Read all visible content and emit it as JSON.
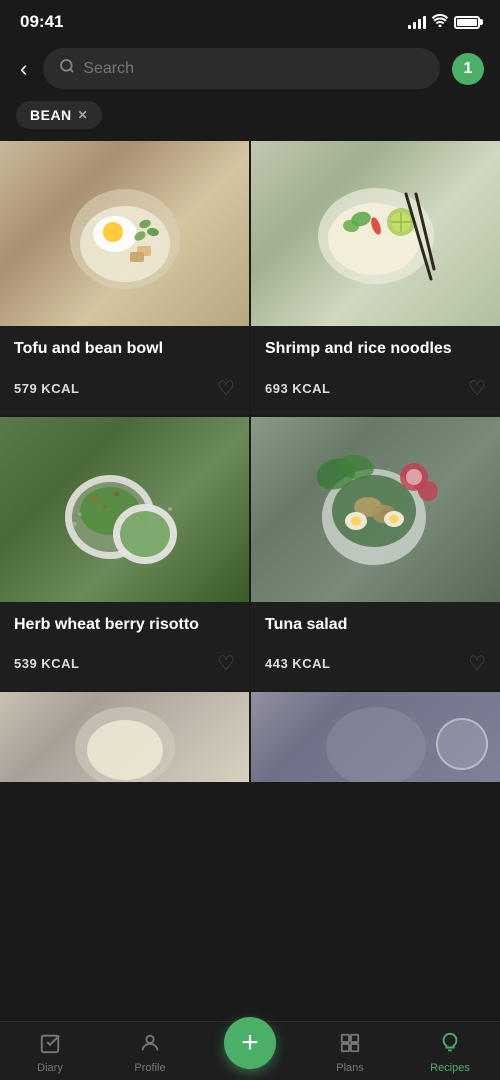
{
  "statusBar": {
    "time": "09:41",
    "signalBars": [
      4,
      7,
      10,
      13
    ],
    "batteryPercent": 85
  },
  "header": {
    "backLabel": "‹",
    "searchPlaceholder": "Search",
    "badgeCount": "1"
  },
  "filters": [
    {
      "label": "BEAN",
      "removable": true
    }
  ],
  "recipes": [
    {
      "id": "tofu-bean-bowl",
      "title": "Tofu and bean bowl",
      "kcal": "579 KCAL",
      "imgType": "tofu",
      "liked": false
    },
    {
      "id": "shrimp-rice-noodles",
      "title": "Shrimp and rice noodles",
      "kcal": "693 KCAL",
      "imgType": "shrimp",
      "liked": false
    },
    {
      "id": "herb-wheat-berry-risotto",
      "title": "Herb wheat berry risotto",
      "kcal": "539 KCAL",
      "imgType": "herb",
      "liked": false
    },
    {
      "id": "tuna-salad",
      "title": "Tuna salad",
      "kcal": "443 KCAL",
      "imgType": "tuna",
      "liked": false
    }
  ],
  "nav": {
    "items": [
      {
        "id": "diary",
        "label": "Diary",
        "icon": "✓",
        "active": false
      },
      {
        "id": "profile",
        "label": "Profile",
        "icon": "👤",
        "active": false
      },
      {
        "id": "add",
        "label": "",
        "icon": "+",
        "active": false
      },
      {
        "id": "plans",
        "label": "Plans",
        "icon": "⊞",
        "active": false
      },
      {
        "id": "recipes",
        "label": "Recipes",
        "icon": "🍳",
        "active": true
      }
    ]
  }
}
